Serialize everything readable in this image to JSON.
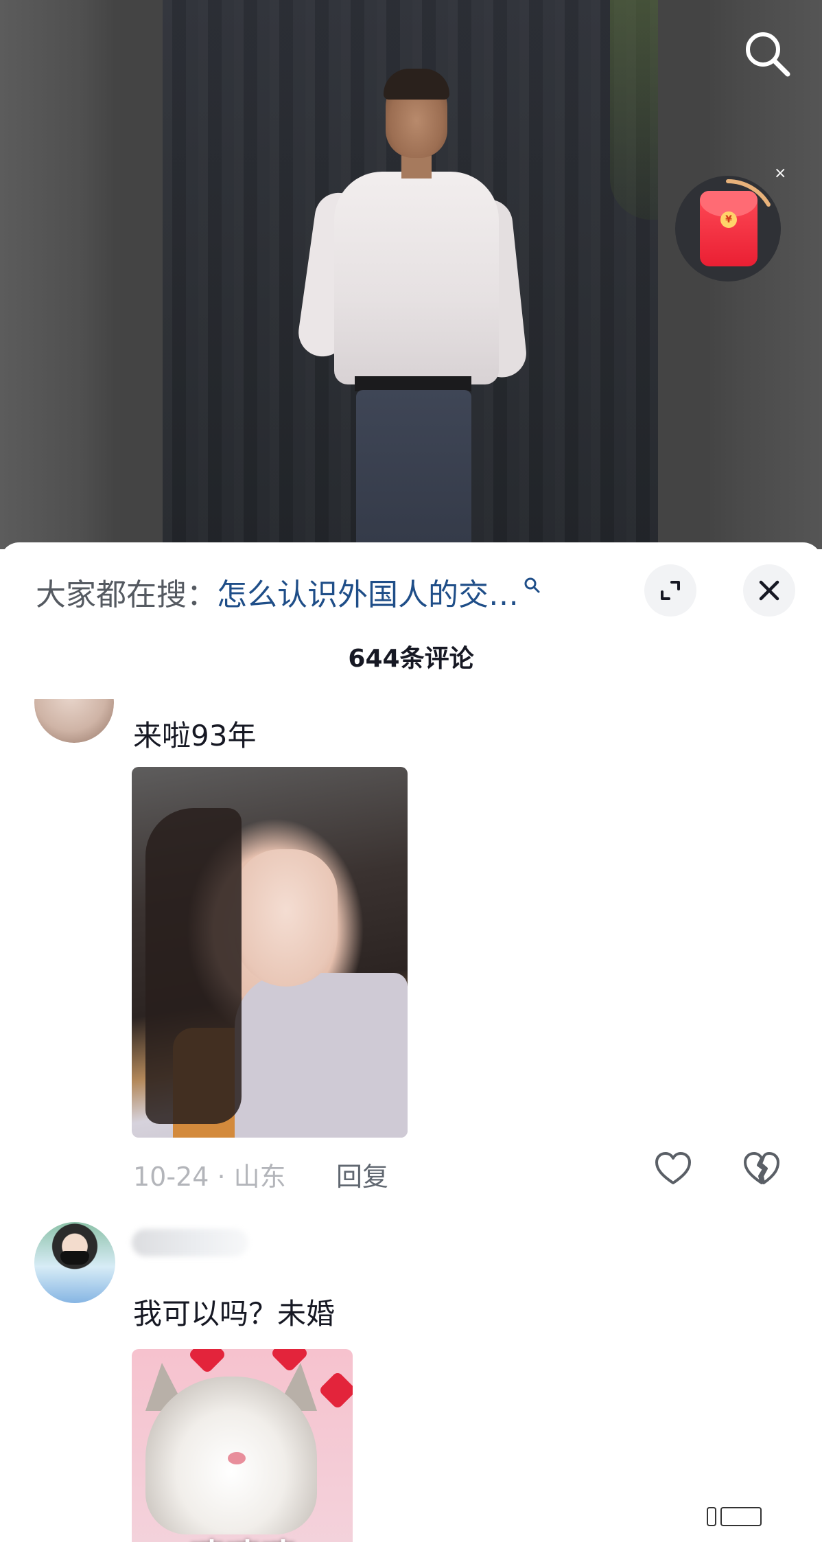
{
  "video": {
    "search_icon": "search-icon",
    "red_packet_icon": "red-packet-icon",
    "red_packet_close": "×"
  },
  "sheet": {
    "search_label": "大家都在搜：",
    "search_query": "怎么认识外国人的交…",
    "expand_icon": "expand-icon",
    "close_icon": "close-icon",
    "comment_count": "644条评论"
  },
  "comments": [
    {
      "text": "来啦93年",
      "meta": "10-24 · 山东",
      "reply_label": "回复",
      "like_icon": "heart-icon",
      "dislike_icon": "broken-heart-icon"
    },
    {
      "text": "我可以吗？未婚",
      "image_caption": "嘻嘻嘻"
    }
  ],
  "colors": {
    "query_link": "#1f4e88",
    "primary_text": "#161823",
    "secondary_text": "#b3b5ba",
    "red_packet": "#ea1f33"
  }
}
